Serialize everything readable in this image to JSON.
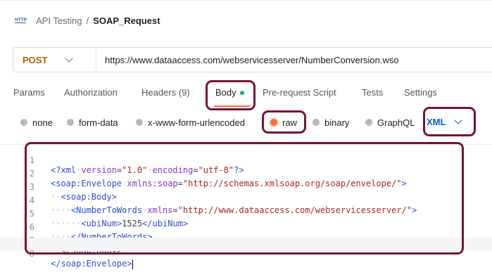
{
  "breadcrumb": {
    "parent": "API Testing",
    "separator": "/",
    "current": "SOAP_Request"
  },
  "request": {
    "method": "POST",
    "url": "https://www.dataaccess.com/webservicesserver/NumberConversion.wso"
  },
  "tabs": [
    {
      "label": "Params"
    },
    {
      "label": "Authorization"
    },
    {
      "label": "Headers (9)"
    },
    {
      "label": "Body",
      "active": true
    },
    {
      "label": "Pre-request Script"
    },
    {
      "label": "Tests"
    },
    {
      "label": "Settings"
    }
  ],
  "body_types": [
    {
      "label": "none"
    },
    {
      "label": "form-data"
    },
    {
      "label": "x-www-form-urlencoded"
    },
    {
      "label": "raw",
      "selected": true
    },
    {
      "label": "binary"
    },
    {
      "label": "GraphQL"
    }
  ],
  "raw_format": "XML",
  "editor": {
    "line_numbers": [
      "1",
      "2",
      "3",
      "4",
      "5",
      "6",
      "7",
      "8"
    ],
    "lines": [
      "<?xml version=\"1.0\" encoding=\"utf-8\"?>",
      "<soap:Envelope xmlns:soap=\"http://schemas.xmlsoap.org/soap/envelope/\">",
      "  <soap:Body>",
      "    <NumberToWords xmlns=\"http://www.dataaccess.com/webservicesserver/\">",
      "      <ubiNum>1525</ubiNum>",
      "    </NumberToWords>",
      "  </soap:Body>",
      "</soap:Envelope>"
    ]
  },
  "colors": {
    "accent": "#ff6c37",
    "method": "#b35c00",
    "xml_select": "#0a58ca",
    "highlight_box": "#7a1230",
    "active_dot": "#0cbb52"
  }
}
